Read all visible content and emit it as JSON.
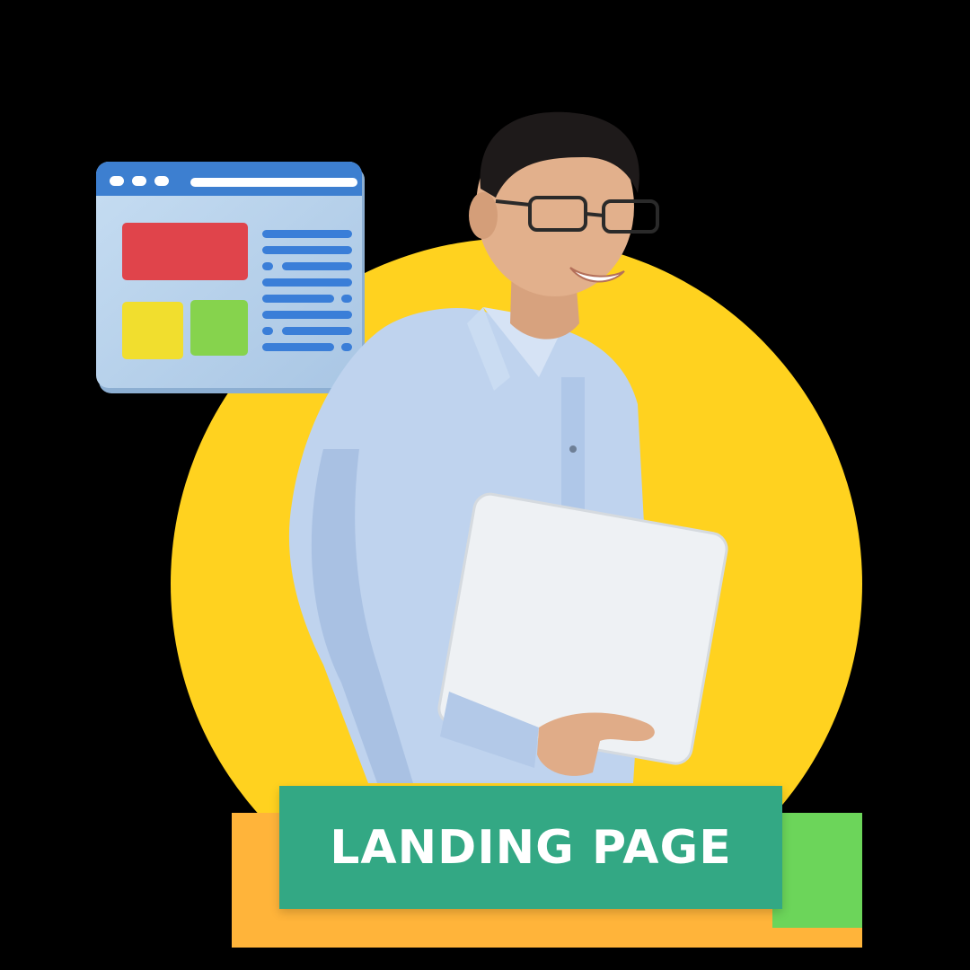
{
  "banner": {
    "label": "LANDING PAGE"
  },
  "illustration": {
    "icon": "browser-window-icon"
  },
  "photo": {
    "subject": "person-holding-laptop"
  },
  "colors": {
    "background": "#000000",
    "circle": "#FFD21F",
    "banner": "#33A884",
    "accent_orange": "#FFB43A",
    "accent_green": "#6CD55A",
    "browser_frame": "#3D7FD0",
    "browser_body": "#B9D3EC",
    "block_red": "#E0444B",
    "block_yellow": "#F1DE2E",
    "block_green": "#86D34D",
    "line_blue": "#3A7ED8"
  }
}
